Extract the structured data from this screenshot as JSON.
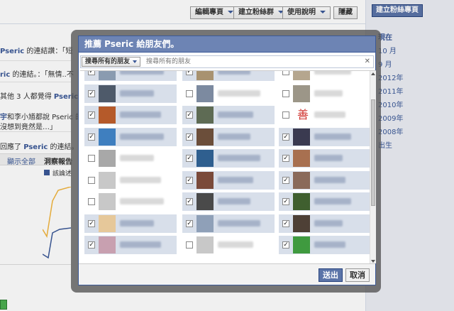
{
  "toolbar": {
    "edit_page": "編輯專頁",
    "build_audience": "建立粉絲群",
    "help": "使用說明",
    "hide": "隱藏"
  },
  "sidebar": {
    "create_page": "建立粉絲專頁",
    "timeline": [
      "現在",
      "10 月",
      "9 月",
      "2012年",
      "2011年",
      "2010年",
      "2009年",
      "2008年",
      "出生"
    ]
  },
  "feed": {
    "lines": [
      {
        "prefix": "",
        "name": "Pseric",
        "text": " 的連結讚：「短"
      },
      {
        "prefix": "",
        "name": "ric",
        "text": " 的連結。：「無情..不"
      },
      {
        "prefix": "其他 3 人都覺得 ",
        "name": "Pseric",
        "text": " 的"
      },
      {
        "prefix": "",
        "name": "宇",
        "text": "和李小馗都說 Pseric 的"
      },
      {
        "prefix": "",
        "name": "",
        "text": "沒想到竟然是…」"
      },
      {
        "prefix": "回應了 ",
        "name": "Pseric",
        "text": " 的連結。"
      }
    ],
    "show_all": "顯示全部",
    "insights": "洞察報告",
    "legend": "該論述"
  },
  "dialog": {
    "title": "推薦 Pseric 給朋友們。",
    "filter_label": "搜尋所有的朋友",
    "search_placeholder": "搜尋所有的朋友",
    "clear": "✕",
    "send": "送出",
    "cancel": "取消",
    "glyph_text": "善"
  },
  "friends": [
    {
      "checked": true,
      "avatar": "#8a9bb0"
    },
    {
      "checked": true,
      "avatar": "#a89270"
    },
    {
      "checked": false,
      "avatar": "#b5a68e"
    },
    {
      "checked": true,
      "avatar": "#4e5a6a"
    },
    {
      "checked": false,
      "avatar": "#7c8aa0"
    },
    {
      "checked": false,
      "avatar": "#9c9688"
    },
    {
      "checked": true,
      "avatar": "#b55a2a"
    },
    {
      "checked": true,
      "avatar": "#5e6b54"
    },
    {
      "checked": false,
      "avatar": "glyph"
    },
    {
      "checked": true,
      "avatar": "#3f7fbf"
    },
    {
      "checked": true,
      "avatar": "#6b4e3a"
    },
    {
      "checked": true,
      "avatar": "#3a3a50"
    },
    {
      "checked": false,
      "avatar": "#a8a8a8"
    },
    {
      "checked": true,
      "avatar": "#2f5f8f"
    },
    {
      "checked": true,
      "avatar": "#a87050"
    },
    {
      "checked": false,
      "avatar": "#c8c8c8"
    },
    {
      "checked": true,
      "avatar": "#7a4a3a"
    },
    {
      "checked": true,
      "avatar": "#8a6a5a"
    },
    {
      "checked": false,
      "avatar": "#c8c8c8"
    },
    {
      "checked": true,
      "avatar": "#4a4a4a"
    },
    {
      "checked": true,
      "avatar": "#3f5f2f"
    },
    {
      "checked": true,
      "avatar": "#e6c89a"
    },
    {
      "checked": true,
      "avatar": "#8fa0b8"
    },
    {
      "checked": true,
      "avatar": "#4e4036"
    },
    {
      "checked": true,
      "avatar": "#c8a0b0"
    },
    {
      "checked": false,
      "avatar": "#c8c8c8"
    },
    {
      "checked": true,
      "avatar": "#3f9a3f"
    }
  ],
  "colors": {
    "brand": "#3b5998",
    "selected_cell": "#d8dfea",
    "title_bar": "#6d84b4"
  }
}
